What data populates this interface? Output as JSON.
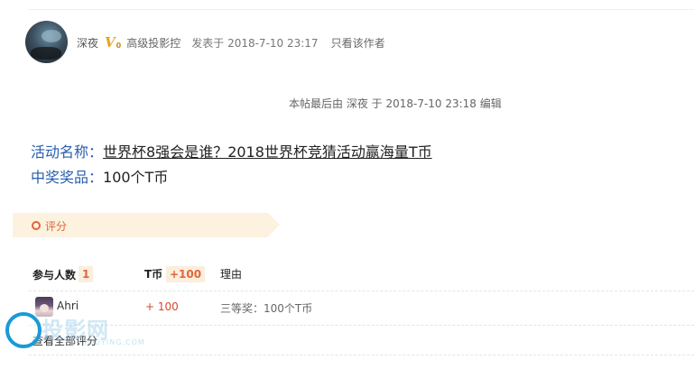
{
  "post": {
    "author": "深夜",
    "vip_badge": "V",
    "vip_badge_sub": "0",
    "level": "高级投影控",
    "posted_at": "发表于 2018-7-10 23:17",
    "only_author": "只看该作者",
    "edit_note": "本帖最后由 深夜 于 2018-7-10 23:18 编辑"
  },
  "content": {
    "activity_label": "活动名称：",
    "activity_title": "世界杯8强会是谁？2018世界杯竞猜活动赢海量T币",
    "prize_label": "中奖奖品：",
    "prize_value": "100个T币"
  },
  "rating": {
    "banner_label": "评分",
    "header": {
      "participants_label": "参与人数",
      "participants_count": "1",
      "tcoin_label": "T币",
      "tcoin_total": "+100",
      "reason_label": "理由"
    },
    "rows": [
      {
        "user": "Ahri",
        "score": "+ 100",
        "reason": "三等奖：100个T币"
      }
    ],
    "view_all": "查看全部评分"
  },
  "watermark": {
    "text": "投影网",
    "sub": "TOUYING.COM"
  },
  "colors": {
    "link_blue": "#2a5db0",
    "accent_orange": "#e0663c",
    "banner_bg": "#fdf1df",
    "vip_gold": "#e8a419"
  }
}
